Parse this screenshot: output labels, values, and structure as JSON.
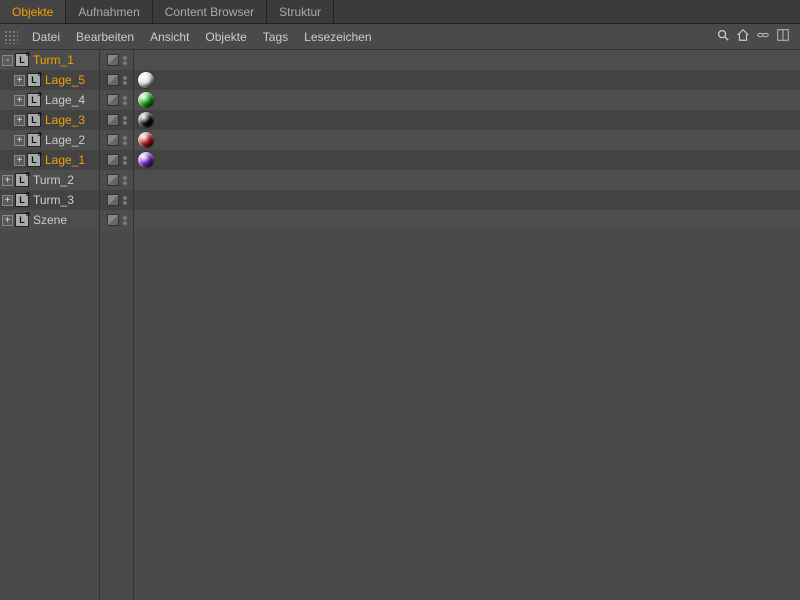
{
  "tabs": [
    "Objekte",
    "Aufnahmen",
    "Content Browser",
    "Struktur"
  ],
  "active_tab_index": 0,
  "menu": [
    "Datei",
    "Bearbeiten",
    "Ansicht",
    "Objekte",
    "Tags",
    "Lesezeichen"
  ],
  "tree": [
    {
      "name": "Turm_1",
      "depth": 0,
      "expander": "-",
      "selected": true,
      "material": null,
      "shade": "light"
    },
    {
      "name": "Lage_5",
      "depth": 1,
      "expander": "+",
      "selected": true,
      "material": "#e8e8e8",
      "shade": "dark"
    },
    {
      "name": "Lage_4",
      "depth": 1,
      "expander": "+",
      "selected": false,
      "material": "#15a515",
      "shade": "light"
    },
    {
      "name": "Lage_3",
      "depth": 1,
      "expander": "+",
      "selected": true,
      "material": "#0a0a0a",
      "shade": "dark"
    },
    {
      "name": "Lage_2",
      "depth": 1,
      "expander": "+",
      "selected": false,
      "material": "#b01515",
      "shade": "light"
    },
    {
      "name": "Lage_1",
      "depth": 1,
      "expander": "+",
      "selected": true,
      "material": "#7020c0",
      "shade": "dark"
    },
    {
      "name": "Turm_2",
      "depth": 0,
      "expander": "+",
      "selected": false,
      "material": null,
      "shade": "light"
    },
    {
      "name": "Turm_3",
      "depth": 0,
      "expander": "+",
      "selected": false,
      "material": null,
      "shade": "dark"
    },
    {
      "name": "Szene",
      "depth": 0,
      "expander": "+",
      "selected": false,
      "material": null,
      "shade": "light"
    }
  ],
  "toolbar_icons": [
    "search-icon",
    "home-icon",
    "link-icon",
    "layout-icon"
  ]
}
